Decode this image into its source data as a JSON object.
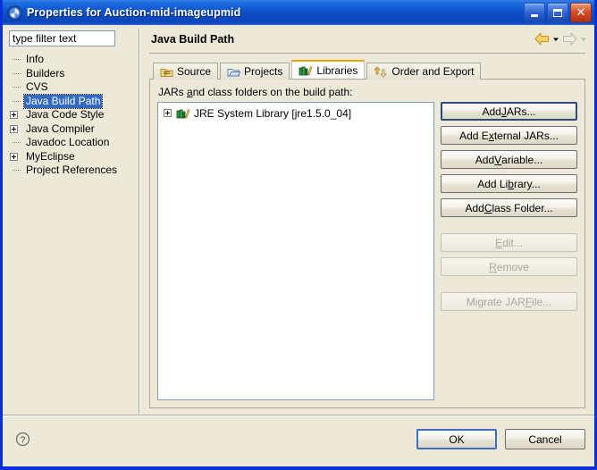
{
  "window": {
    "title": "Properties for Auction-mid-imageupmid",
    "icon": "eclipse-properties-icon",
    "caption": {
      "minimize": "minimize-icon",
      "maximize": "maximize-icon",
      "close": "close-icon"
    },
    "colors": {
      "titlebar_blue": "#0831d9",
      "dialog_face": "#ece9d8",
      "selection_blue": "#316ac5",
      "tab_accent_orange": "#f0a30a",
      "default_button_border": "#3d6ec4"
    }
  },
  "sidebar": {
    "filter": {
      "value": "type filter text",
      "placeholder": "type filter text"
    },
    "items": [
      {
        "label": "Info",
        "expandable": false,
        "selected": false
      },
      {
        "label": "Builders",
        "expandable": false,
        "selected": false
      },
      {
        "label": "CVS",
        "expandable": false,
        "selected": false
      },
      {
        "label": "Java Build Path",
        "expandable": false,
        "selected": true
      },
      {
        "label": "Java Code Style",
        "expandable": true,
        "selected": false
      },
      {
        "label": "Java Compiler",
        "expandable": true,
        "selected": false
      },
      {
        "label": "Javadoc Location",
        "expandable": false,
        "selected": false
      },
      {
        "label": "MyEclipse",
        "expandable": true,
        "selected": false
      },
      {
        "label": "Project References",
        "expandable": false,
        "selected": false
      }
    ]
  },
  "main": {
    "page_title": "Java Build Path",
    "nav": {
      "back": "back-arrow-icon",
      "back_menu": "dropdown-arrow-icon",
      "forward": "forward-arrow-icon",
      "forward_menu": "dropdown-arrow-icon"
    },
    "tabs": [
      {
        "label": "Source",
        "icon": "source-folder-icon",
        "active": false
      },
      {
        "label": "Projects",
        "icon": "projects-folder-icon",
        "active": false
      },
      {
        "label": "Libraries",
        "icon": "libraries-books-icon",
        "active": true
      },
      {
        "label": "Order and Export",
        "icon": "order-export-arrows-icon",
        "active": false
      }
    ],
    "panel": {
      "label_prefix": "JARs ",
      "label_mnemonic": "a",
      "label_suffix": "nd class folders on the build path:",
      "entries": [
        {
          "label": "JRE System Library [jre1.5.0_04]",
          "icon": "library-books-icon",
          "expandable": true
        }
      ]
    },
    "buttons": [
      {
        "pre": "Add ",
        "key": "J",
        "post": "ARs...",
        "enabled": true,
        "focused": true,
        "name": "add-jars-button"
      },
      {
        "pre": "Add E",
        "key": "x",
        "post": "ternal JARs...",
        "enabled": true,
        "focused": false,
        "name": "add-external-jars-button"
      },
      {
        "pre": "Add ",
        "key": "V",
        "post": "ariable...",
        "enabled": true,
        "focused": false,
        "name": "add-variable-button"
      },
      {
        "pre": "Add Li",
        "key": "b",
        "post": "rary...",
        "enabled": true,
        "focused": false,
        "name": "add-library-button"
      },
      {
        "pre": "Add ",
        "key": "C",
        "post": "lass Folder...",
        "enabled": true,
        "focused": false,
        "name": "add-class-folder-button"
      },
      {
        "pre": "",
        "key": "E",
        "post": "dit...",
        "enabled": false,
        "focused": false,
        "name": "edit-button"
      },
      {
        "pre": "",
        "key": "R",
        "post": "emove",
        "enabled": false,
        "focused": false,
        "name": "remove-button"
      },
      {
        "pre": "Migrate JAR ",
        "key": "F",
        "post": "ile...",
        "enabled": false,
        "focused": false,
        "name": "migrate-jar-file-button"
      }
    ]
  },
  "footer": {
    "help": "help-question-icon",
    "ok_label": "OK",
    "cancel_label": "Cancel"
  }
}
